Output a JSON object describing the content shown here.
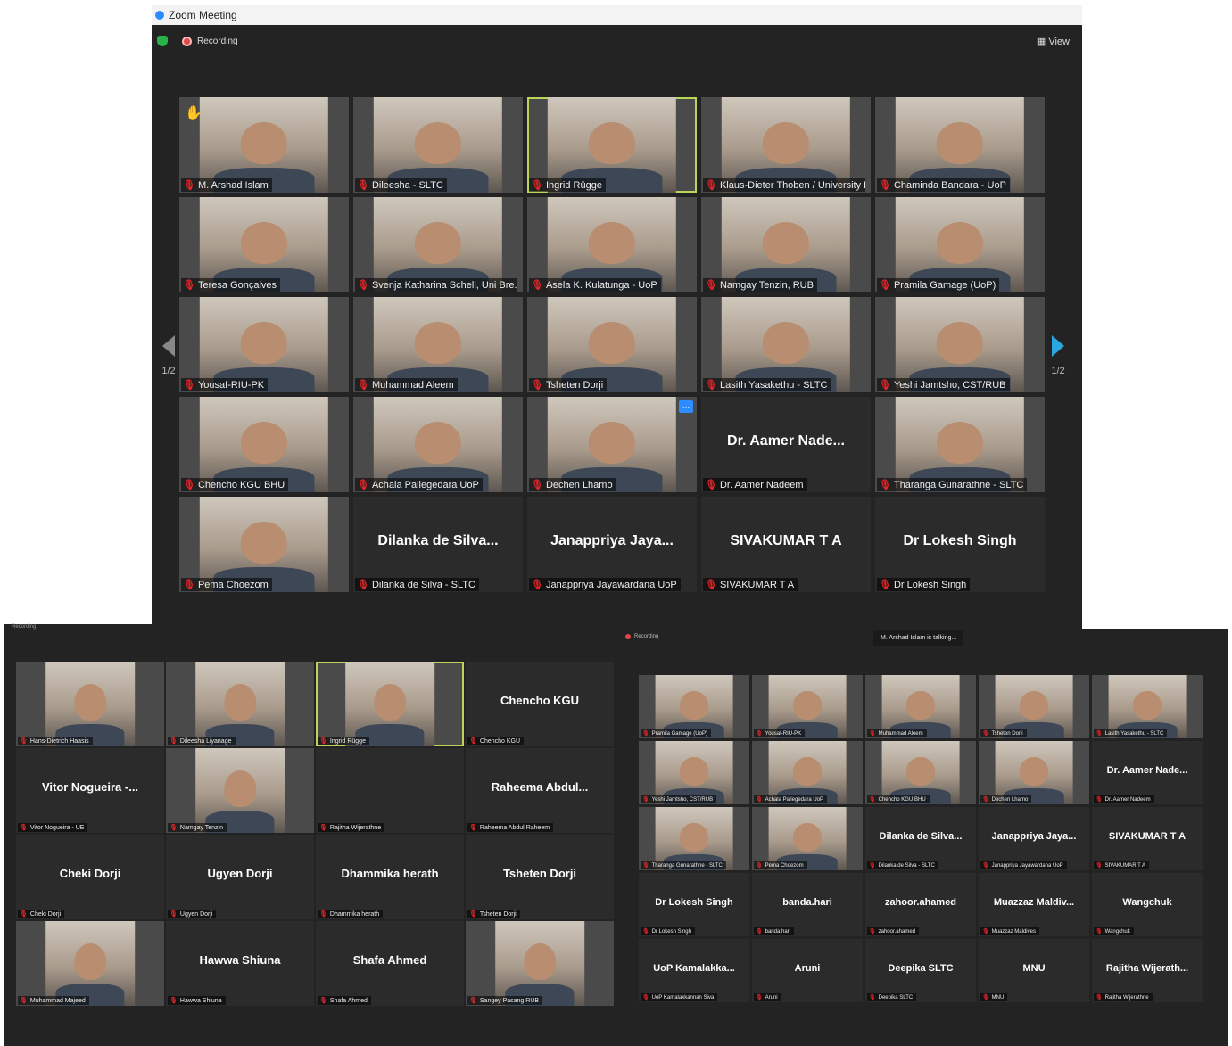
{
  "app": {
    "title": "Zoom Meeting"
  },
  "main": {
    "recording_label": "Recording",
    "view_label": "View",
    "page_indicator": "1/2",
    "tiles": [
      {
        "name": "M. Arshad Islam",
        "display": "",
        "video": true,
        "hand": true
      },
      {
        "name": "Dileesha - SLTC",
        "display": "",
        "video": true
      },
      {
        "name": "Ingrid Rügge",
        "display": "",
        "video": true,
        "active": true
      },
      {
        "name": "Klaus-Dieter Thoben / University B...",
        "display": "",
        "video": true
      },
      {
        "name": "Chaminda Bandara - UoP",
        "display": "",
        "video": true
      },
      {
        "name": "Teresa Gonçalves",
        "display": "",
        "video": true
      },
      {
        "name": "Svenja Katharina Schell, Uni Bre...",
        "display": "",
        "video": true
      },
      {
        "name": "Asela K. Kulatunga - UoP",
        "display": "",
        "video": true
      },
      {
        "name": "Namgay Tenzin, RUB",
        "display": "",
        "video": true
      },
      {
        "name": "Pramila Gamage (UoP)",
        "display": "",
        "video": true
      },
      {
        "name": "Yousaf-RIU-PK",
        "display": "",
        "video": true
      },
      {
        "name": "Muhammad Aleem",
        "display": "",
        "video": true
      },
      {
        "name": "Tsheten Dorji",
        "display": "",
        "video": true
      },
      {
        "name": "Lasith Yasakethu - SLTC",
        "display": "",
        "video": true
      },
      {
        "name": "Yeshi Jamtsho, CST/RUB",
        "display": "",
        "video": true
      },
      {
        "name": "Chencho KGU BHU",
        "display": "",
        "video": true
      },
      {
        "name": "Achala Pallegedara UoP",
        "display": "",
        "video": true
      },
      {
        "name": "Dechen Lhamo",
        "display": "",
        "video": true,
        "more": true
      },
      {
        "name": "Dr. Aamer Nadeem",
        "display": "Dr. Aamer Nade...",
        "video": false
      },
      {
        "name": "Tharanga Gunarathne - SLTC",
        "display": "",
        "video": true
      },
      {
        "name": "Pema Choezom",
        "display": "",
        "video": true
      },
      {
        "name": "Dilanka de Silva - SLTC",
        "display": "Dilanka de Silva...",
        "video": false
      },
      {
        "name": "Janappriya Jayawardana UoP",
        "display": "Janappriya Jaya...",
        "video": false
      },
      {
        "name": "SIVAKUMAR T A",
        "display": "SIVAKUMAR T A",
        "video": false
      },
      {
        "name": "Dr Lokesh Singh",
        "display": "Dr Lokesh Singh",
        "video": false
      }
    ]
  },
  "second": {
    "recording_label": "Recording",
    "tiles": [
      {
        "name": "Hans-Dietrich Haasis",
        "display": "",
        "video": true
      },
      {
        "name": "Dileesha Liyanage",
        "display": "",
        "video": true
      },
      {
        "name": "Ingrid Rügge",
        "display": "",
        "video": true,
        "active": true
      },
      {
        "name": "Chencho KGU",
        "display": "Chencho KGU",
        "video": false
      },
      {
        "name": "Vitor Nogueira - UE",
        "display": "Vitor Nogueira -...",
        "video": false
      },
      {
        "name": "Namgay Tenzin",
        "display": "",
        "video": true
      },
      {
        "name": "Rajitha Wijerathne",
        "display": "",
        "video": false
      },
      {
        "name": "Raheema Abdul Raheem",
        "display": "Raheema Abdul...",
        "video": false
      },
      {
        "name": "Cheki Dorji",
        "display": "Cheki Dorji",
        "video": false
      },
      {
        "name": "Ugyen Dorji",
        "display": "Ugyen Dorji",
        "video": false
      },
      {
        "name": "Dhammika herath",
        "display": "Dhammika herath",
        "video": false
      },
      {
        "name": "Tsheten Dorji",
        "display": "Tsheten Dorji",
        "video": false
      },
      {
        "name": "Muhammad Majeed",
        "display": "",
        "video": true
      },
      {
        "name": "Hawwa Shiuna",
        "display": "Hawwa Shiuna",
        "video": false
      },
      {
        "name": "Shafa Ahmed",
        "display": "Shafa Ahmed",
        "video": false
      },
      {
        "name": "Sangey Pasang RUB",
        "display": "",
        "video": true
      }
    ]
  },
  "third": {
    "recording_label": "Recording",
    "talking_label": "M. Arshad Islam is talking...",
    "tiles": [
      {
        "name": "Pramila Gamage (UoP)",
        "display": "",
        "video": true
      },
      {
        "name": "Yousaf-RIU-PK",
        "display": "",
        "video": true
      },
      {
        "name": "Muhammad Aleem",
        "display": "",
        "video": true
      },
      {
        "name": "Tsheten Dorji",
        "display": "",
        "video": true
      },
      {
        "name": "Lasith Yasakethu - SLTC",
        "display": "",
        "video": true
      },
      {
        "name": "Yeshi Jamtsho, CST/RUB",
        "display": "",
        "video": true
      },
      {
        "name": "Achala Pallegedara UoP",
        "display": "",
        "video": true
      },
      {
        "name": "Chencho KGU BHU",
        "display": "",
        "video": true
      },
      {
        "name": "Dechen Lhamo",
        "display": "",
        "video": true
      },
      {
        "name": "Dr. Aamer Nadeem",
        "display": "Dr. Aamer Nade...",
        "video": false
      },
      {
        "name": "Tharanga Gunarathne - SLTC",
        "display": "",
        "video": true
      },
      {
        "name": "Pema Choezom",
        "display": "",
        "video": true
      },
      {
        "name": "Dilanka de Silva - SLTC",
        "display": "Dilanka de Silva...",
        "video": false
      },
      {
        "name": "Janappriya Jayawardana UoP",
        "display": "Janappriya Jaya...",
        "video": false
      },
      {
        "name": "SIVAKUMAR T A",
        "display": "SIVAKUMAR T A",
        "video": false
      },
      {
        "name": "Dr Lokesh Singh",
        "display": "Dr Lokesh Singh",
        "video": false
      },
      {
        "name": "banda.hari",
        "display": "banda.hari",
        "video": false
      },
      {
        "name": "zahoor.ahamed",
        "display": "zahoor.ahamed",
        "video": false
      },
      {
        "name": "Muazzaz Maldives",
        "display": "Muazzaz Maldiv...",
        "video": false
      },
      {
        "name": "Wangchuk",
        "display": "Wangchuk",
        "video": false
      },
      {
        "name": "UoP Kamalakkannan Siva",
        "display": "UoP Kamalakka...",
        "video": false
      },
      {
        "name": "Aruni",
        "display": "Aruni",
        "video": false
      },
      {
        "name": "Deepika SLTC",
        "display": "Deepika SLTC",
        "video": false
      },
      {
        "name": "MNU",
        "display": "MNU",
        "video": false
      },
      {
        "name": "Rajitha Wijerathne",
        "display": "Rajitha Wijerath...",
        "video": false
      }
    ]
  },
  "colors": {
    "background": "#232323",
    "tile": "#2b2b2b",
    "active_border": "#b9d65a",
    "mute_icon": "#e44444",
    "next_arrow": "#2aa7e0"
  },
  "icons": [
    "zoom-logo-icon",
    "security-shield-icon",
    "recording-icon",
    "view-grid-icon",
    "muted-mic-icon",
    "raised-hand-icon",
    "previous-page-icon",
    "next-page-icon",
    "more-options-icon"
  ]
}
